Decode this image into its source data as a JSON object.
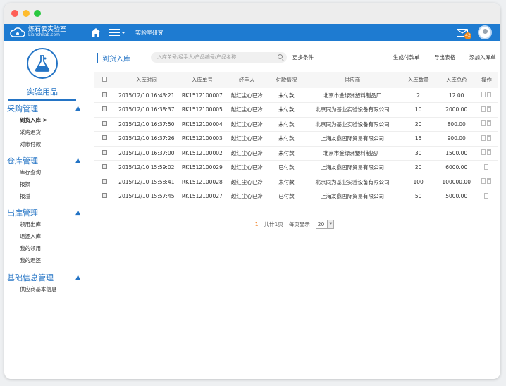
{
  "app": {
    "brand_zh": "炼石云实验室",
    "brand_en": "Lianshilab.com",
    "nav_label": "实验室研究",
    "mail_count": "42",
    "accent_color": "#1e7bd1"
  },
  "sidebar": {
    "title": "实验用品",
    "groups": [
      {
        "label": "采购管理",
        "items": [
          "到货入库",
          "采购退货",
          "对账付款"
        ]
      },
      {
        "label": "仓库管理",
        "items": [
          "库存查询",
          "报损",
          "报溢"
        ]
      },
      {
        "label": "出库管理",
        "items": [
          "领用出库",
          "退还入库",
          "我的领用",
          "我的退还"
        ]
      },
      {
        "label": "基础信息管理",
        "items": [
          "供应商基本信息"
        ]
      }
    ],
    "active_arrow": ">"
  },
  "toolbar": {
    "title": "到货入库",
    "search_placeholder": "入库单号/经手人/产品编号/产品名称",
    "more": "更多条件",
    "actions": [
      "生成付款单",
      "导出表格",
      "添加入库单"
    ]
  },
  "table": {
    "headers": [
      "入库时间",
      "入库单号",
      "经手人",
      "付款情况",
      "供应商",
      "入库数量",
      "入库总价",
      "操作"
    ],
    "rows": [
      [
        "2015/12/10 16:43:21",
        "RK1512100007",
        "越红尘心已冷",
        "未付款",
        "北京市金绿洲塑料制品厂",
        "2",
        "12.00",
        true
      ],
      [
        "2015/12/10 16:38:37",
        "RK1512100005",
        "越红尘心已冷",
        "未付款",
        "北京同为基业实验设备有限公司",
        "10",
        "2000.00",
        true
      ],
      [
        "2015/12/10 16:37:50",
        "RK1512100004",
        "越红尘心已冷",
        "未付款",
        "北京同为基业实验设备有限公司",
        "20",
        "800.00",
        true
      ],
      [
        "2015/12/10 16:37:26",
        "RK1512100003",
        "越红尘心已冷",
        "未付款",
        "上海友鼎国际贸易有限公司",
        "15",
        "900.00",
        true
      ],
      [
        "2015/12/10 16:37:00",
        "RK1512100002",
        "越红尘心已冷",
        "未付款",
        "北京市金绿洲塑料制品厂",
        "30",
        "1500.00",
        true
      ],
      [
        "2015/12/10 15:59:02",
        "RK1512100029",
        "越红尘心已冷",
        "已付款",
        "上海友鼎国际贸易有限公司",
        "20",
        "6000.00",
        false
      ],
      [
        "2015/12/10 15:58:41",
        "RK1512100028",
        "越红尘心已冷",
        "未付款",
        "北京同为基业实验设备有限公司",
        "100",
        "100000.00",
        true
      ],
      [
        "2015/12/10 15:57:45",
        "RK1512100027",
        "越红尘心已冷",
        "已付款",
        "上海友鼎国际贸易有限公司",
        "50",
        "5000.00",
        false
      ]
    ]
  },
  "pager": {
    "current": "1",
    "total": "共计1页",
    "per_page_label": "每页显示",
    "per_page": "20"
  }
}
